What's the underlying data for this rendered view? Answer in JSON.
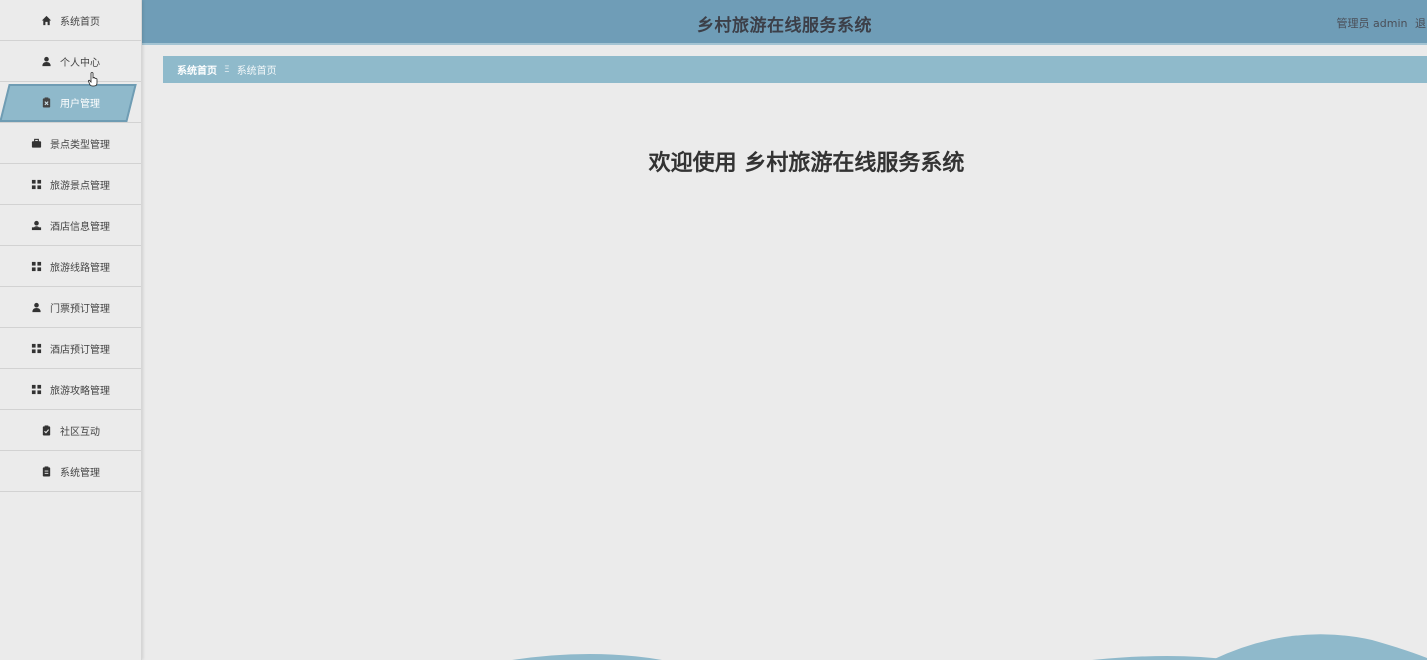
{
  "header": {
    "title": "乡村旅游在线服务系统",
    "user_label": "管理员 admin",
    "logout_label": "退出"
  },
  "sidebar": {
    "items": [
      {
        "label": "系统首页",
        "icon": "home-icon"
      },
      {
        "label": "个人中心",
        "icon": "user-icon"
      },
      {
        "label": "用户管理",
        "icon": "clipboard-x-icon"
      },
      {
        "label": "景点类型管理",
        "icon": "briefcase-icon"
      },
      {
        "label": "旅游景点管理",
        "icon": "grid-icon"
      },
      {
        "label": "酒店信息管理",
        "icon": "user-tie-icon"
      },
      {
        "label": "旅游线路管理",
        "icon": "grid-icon"
      },
      {
        "label": "门票预订管理",
        "icon": "user-icon"
      },
      {
        "label": "酒店预订管理",
        "icon": "grid-icon"
      },
      {
        "label": "旅游攻略管理",
        "icon": "grid-icon"
      },
      {
        "label": "社区互动",
        "icon": "clipboard-check-icon"
      },
      {
        "label": "系统管理",
        "icon": "clipboard-list-icon"
      }
    ],
    "active_index": 2
  },
  "breadcrumb": {
    "home": "系统首页",
    "separator": "Ξ",
    "current": "系统首页"
  },
  "main": {
    "welcome": "欢迎使用 乡村旅游在线服务系统"
  },
  "colors": {
    "topbar": "#6f9db7",
    "accent": "#8fbacb",
    "background": "#ebebeb"
  }
}
